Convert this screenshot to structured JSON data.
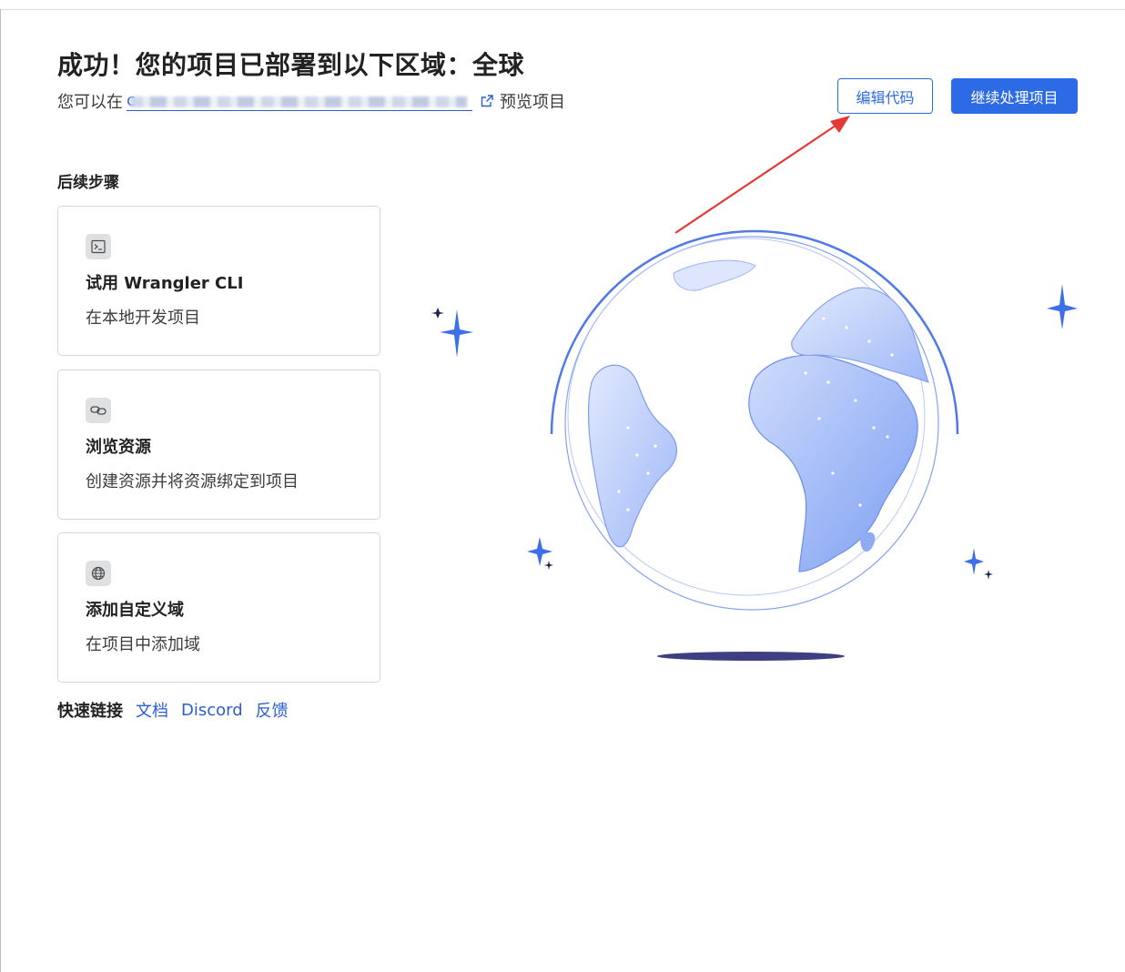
{
  "header": {
    "title": "成功！您的项目已部署到以下区域：全球",
    "subtitle_prefix": "您可以在",
    "url_text": "c",
    "subtitle_suffix": "预览项目"
  },
  "actions": {
    "edit_code": "编辑代码",
    "continue_project": "继续处理项目"
  },
  "next_steps": {
    "heading": "后续步骤",
    "cards": [
      {
        "icon": "terminal-icon",
        "title": "试用 Wrangler CLI",
        "description": "在本地开发项目"
      },
      {
        "icon": "link-icon",
        "title": "浏览资源",
        "description": "创建资源并将资源绑定到项目"
      },
      {
        "icon": "globe-icon",
        "title": "添加自定义域",
        "description": "在项目中添加域"
      }
    ]
  },
  "quick_links": {
    "label": "快速链接",
    "links": [
      "文档",
      "Discord",
      "反馈"
    ]
  },
  "colors": {
    "primary": "#2c6ae6",
    "link": "#2b5fd0",
    "annotation_arrow": "#e53935",
    "globe_fill": "#8aa8f5",
    "sparkle": "#3d6fe8"
  }
}
